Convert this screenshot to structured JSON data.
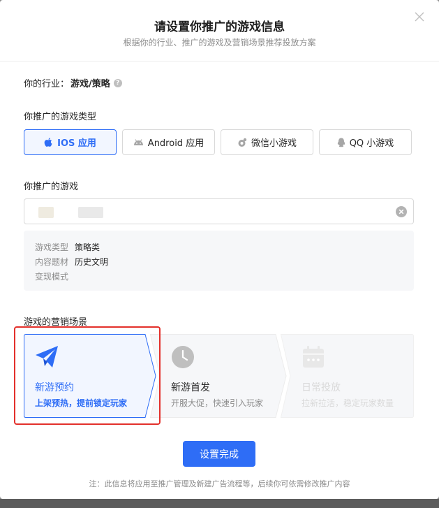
{
  "modal": {
    "title": "请设置你推广的游戏信息",
    "subtitle": "根据你的行业、推广的游戏及营销场景推荐投放方案"
  },
  "industry": {
    "label": "你的行业：",
    "value": "游戏/策略",
    "help_icon": "question-circle-icon"
  },
  "game_type": {
    "label": "你推广的游戏类型",
    "options": [
      {
        "label": "IOS 应用",
        "icon": "apple-icon",
        "selected": true
      },
      {
        "label": "Android 应用",
        "icon": "android-icon",
        "selected": false
      },
      {
        "label": "微信小游戏",
        "icon": "wechat-game-icon",
        "selected": false
      },
      {
        "label": "QQ 小游戏",
        "icon": "qq-icon",
        "selected": false
      }
    ]
  },
  "game": {
    "label": "你推广的游戏",
    "clear_icon": "clear-circle-icon",
    "info": [
      {
        "key": "游戏类型",
        "value": "策略类"
      },
      {
        "key": "内容题材",
        "value": "历史文明"
      },
      {
        "key": "变现模式",
        "value": ""
      }
    ]
  },
  "scene": {
    "label": "游戏的营销场景",
    "options": [
      {
        "name": "新游预约",
        "desc": "上架预热，提前锁定玩家",
        "icon": "paper-plane-icon",
        "state": "selected"
      },
      {
        "name": "新游首发",
        "desc": "开服大促，快速引入玩家",
        "icon": "clock-icon",
        "state": "normal"
      },
      {
        "name": "日常投放",
        "desc": "拉新拉活，稳定玩家数量",
        "icon": "calendar-icon",
        "state": "disabled"
      }
    ]
  },
  "submit_label": "设置完成",
  "note": "注：此信息将应用至推广管理及新建广告流程等，后续你可依需修改推广内容",
  "colors": {
    "primary": "#2e6df6",
    "highlight": "#e3302b"
  }
}
